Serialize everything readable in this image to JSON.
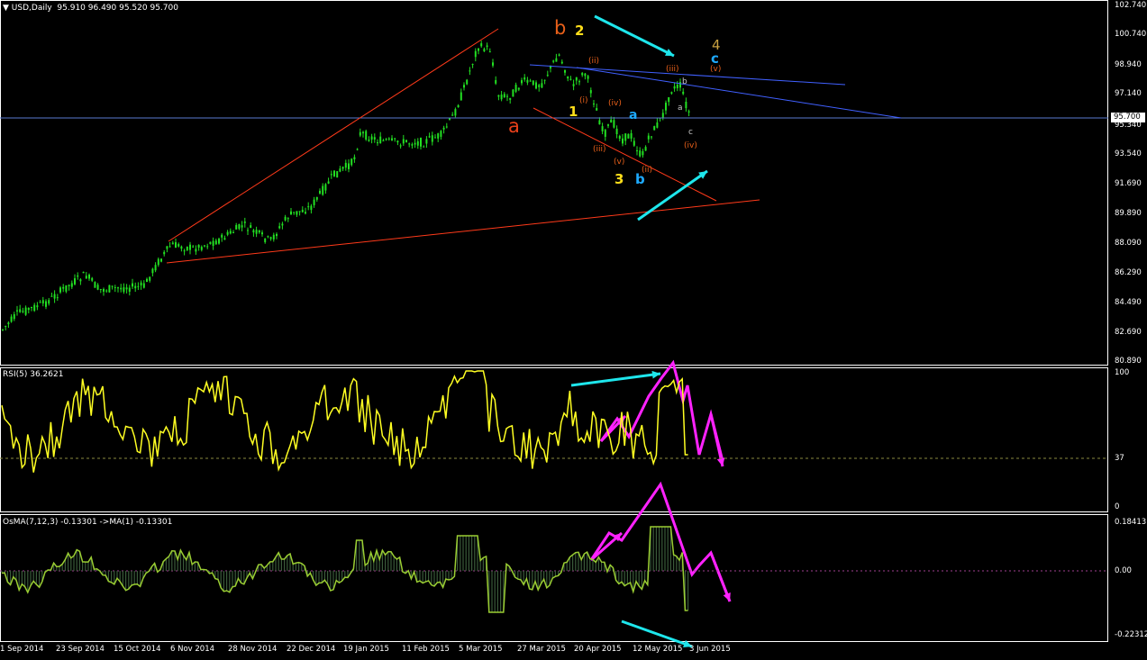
{
  "symbol_header": {
    "title": "USD,Daily",
    "ohlc": "95.910 96.490 95.520 95.700"
  },
  "price_axis": [
    "102.740",
    "100.740",
    "98.940",
    "97.140",
    "95.340",
    "93.540",
    "91.690",
    "89.890",
    "88.090",
    "86.290",
    "84.490",
    "82.690",
    "80.890"
  ],
  "current_price": "95.700",
  "rsi_pane": {
    "label": "RSI(5) 36.2621",
    "axis": [
      "100",
      "37",
      "0"
    ]
  },
  "osma_pane": {
    "label": "OsMA(7,12,3) -0.13301  ->MA(1) -0.13301",
    "axis": [
      "0.18413",
      "0.00",
      "-0.22312"
    ]
  },
  "date_axis": [
    "1 Sep 2014",
    "23 Sep 2014",
    "15 Oct 2014",
    "6 Nov 2014",
    "28 Nov 2014",
    "22 Dec 2014",
    "19 Jan 2015",
    "11 Feb 2015",
    "5 Mar 2015",
    "27 Mar 2015",
    "20 Apr 2015",
    "12 May 2015",
    "3 Jun 2015"
  ],
  "wave_labels": {
    "b_red": "b",
    "a_red": "a",
    "one": "1",
    "two": "2",
    "three": "3",
    "four_top": "4",
    "c_blue": "c",
    "a_blue": "a",
    "b_blue": "b",
    "ii_a": "(ii)",
    "i": "(i)",
    "iii_a": "(iii)",
    "iv_a": "(iv)",
    "v_a": "(v)",
    "ii_b": "(ii)",
    "iii_b": "(iii)",
    "v_b": "(v)",
    "iv_b": "(iv)",
    "b_small": "b",
    "a_small": "a",
    "c_small": "c"
  },
  "colors": {
    "candle": "#22e022",
    "rsi": "#ffff22",
    "osma": "#9acd32",
    "annotation_cyan": "#1ee6ec",
    "annotation_magenta": "#ff22ff",
    "trendline_red": "#ff3a1a",
    "trendline_blue": "#4060ff",
    "wave_orange": "#e8601a",
    "wave_yellow": "#ffde1a",
    "wave_blue": "#1eaaff"
  }
}
